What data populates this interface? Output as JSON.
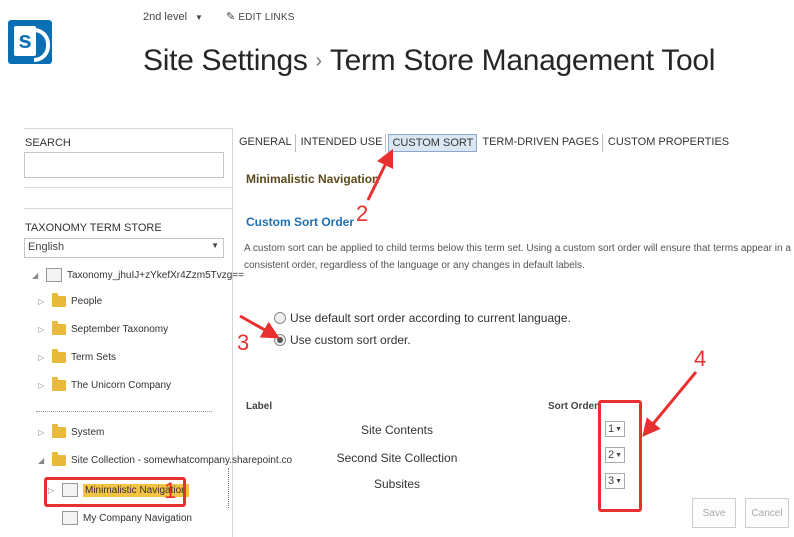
{
  "header": {
    "level": "2nd level",
    "edit_links": "EDIT LINKS",
    "title_part1": "Site Settings",
    "title_part2": "Term Store Management Tool"
  },
  "left": {
    "search_label": "SEARCH",
    "store_label": "TAXONOMY TERM STORE",
    "language": "English",
    "tree": {
      "root": "Taxonomy_jhuIJ+zYkefXr4Zzm5Tvzg==",
      "people": "People",
      "september": "September Taxonomy",
      "termsets": "Term Sets",
      "unicorn": "The Unicorn Company",
      "system": "System",
      "sitecollection": "Site Collection - somewhatcompany.sharepoint.co",
      "minimalistic": "Minimalistic Navigation",
      "mycompany": "My Company Navigation"
    }
  },
  "tabs": [
    "GENERAL",
    "INTENDED USE",
    "CUSTOM SORT",
    "TERM-DRIVEN PAGES",
    "CUSTOM PROPERTIES"
  ],
  "content": {
    "termset_name": "Minimalistic Navigation",
    "section_title": "Custom Sort Order",
    "description": "A custom sort can be applied to child terms below this term set. Using a custom sort order will ensure that terms appear in a consistent order, regardless of the language or any changes in default labels.",
    "radio_default": "Use default sort order according to current language.",
    "radio_custom": "Use custom sort order.",
    "col_label": "Label",
    "col_order": "Sort Order",
    "rows": [
      {
        "label": "Site Contents",
        "order": "1"
      },
      {
        "label": "Second Site Collection",
        "order": "2"
      },
      {
        "label": "Subsites",
        "order": "3"
      }
    ],
    "save": "Save",
    "cancel": "Cancel"
  },
  "annotations": {
    "n1": "1",
    "n2": "2",
    "n3": "3",
    "n4": "4"
  },
  "colors": {
    "accent": "#0b6fb3",
    "annotation": "#e8312f",
    "selected": "#f5c342"
  }
}
